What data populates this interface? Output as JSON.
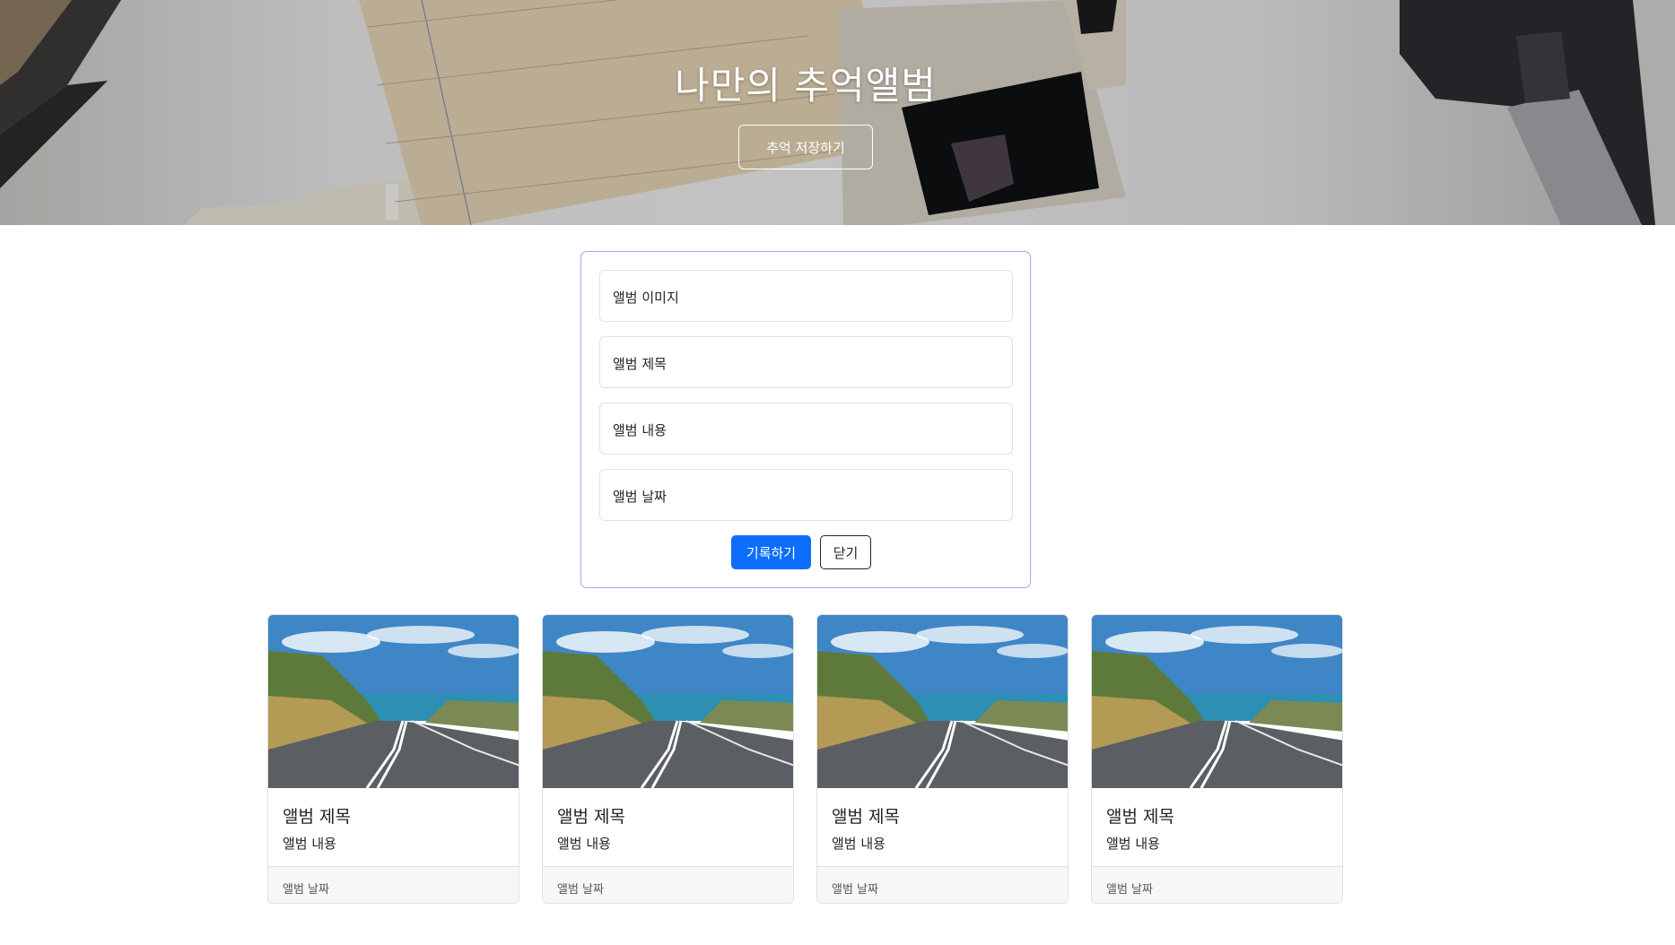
{
  "hero": {
    "title": "나만의 추억앨범",
    "save_button_label": "추억 저장하기"
  },
  "form": {
    "fields": [
      {
        "label": "앨범 이미지"
      },
      {
        "label": "앨범 제목"
      },
      {
        "label": "앨범 내용"
      },
      {
        "label": "앨범 날짜"
      }
    ],
    "submit_label": "기록하기",
    "close_label": "닫기"
  },
  "cards": [
    {
      "image": "coastal-road-photo",
      "title": "앨범 제목",
      "text": "앨범 내용",
      "date": "앨범 날짜"
    },
    {
      "image": "coastal-road-photo",
      "title": "앨범 제목",
      "text": "앨범 내용",
      "date": "앨범 날짜"
    },
    {
      "image": "coastal-road-photo",
      "title": "앨범 제목",
      "text": "앨범 내용",
      "date": "앨범 날짜"
    },
    {
      "image": "coastal-road-photo",
      "title": "앨범 제목",
      "text": "앨범 내용",
      "date": "앨범 날짜"
    }
  ],
  "colors": {
    "primary": "#0d6efd",
    "form_border": "#a6a6f2",
    "footer_bg": "#f7f7f7"
  }
}
